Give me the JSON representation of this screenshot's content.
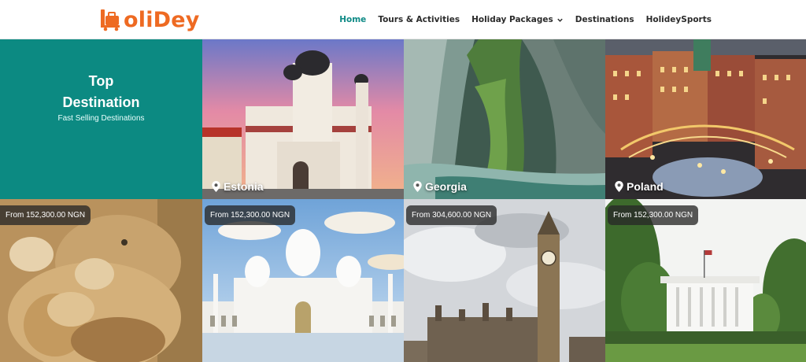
{
  "header": {
    "logo": {
      "brand": "HoliDey",
      "text": "oliDey",
      "color": "#ee6a22"
    },
    "nav": [
      {
        "label": "Home",
        "active": true
      },
      {
        "label": "Tours & Activities",
        "active": false
      },
      {
        "label": "Holiday Packages",
        "active": false,
        "dropdown": true
      },
      {
        "label": "Destinations",
        "active": false
      },
      {
        "label": "HolideySports",
        "active": false
      }
    ],
    "accent": "#0f8a86"
  },
  "hero": {
    "title_line1": "Top",
    "title_line2": "Destination",
    "subtitle": "Fast Selling Destinations",
    "background": "#0c8a82"
  },
  "destinations": [
    {
      "name": "Estonia",
      "icon": "map-pin-icon"
    },
    {
      "name": "Georgia",
      "icon": "map-pin-icon"
    },
    {
      "name": "Poland",
      "icon": "map-pin-icon"
    }
  ],
  "packages": [
    {
      "price": "From 152,300.00 NGN",
      "image": "lions"
    },
    {
      "price": "From 152,300.00 NGN",
      "image": "mosque"
    },
    {
      "price": "From 304,600.00 NGN",
      "image": "big-ben"
    },
    {
      "price": "From 152,300.00 NGN",
      "image": "white-house"
    }
  ]
}
